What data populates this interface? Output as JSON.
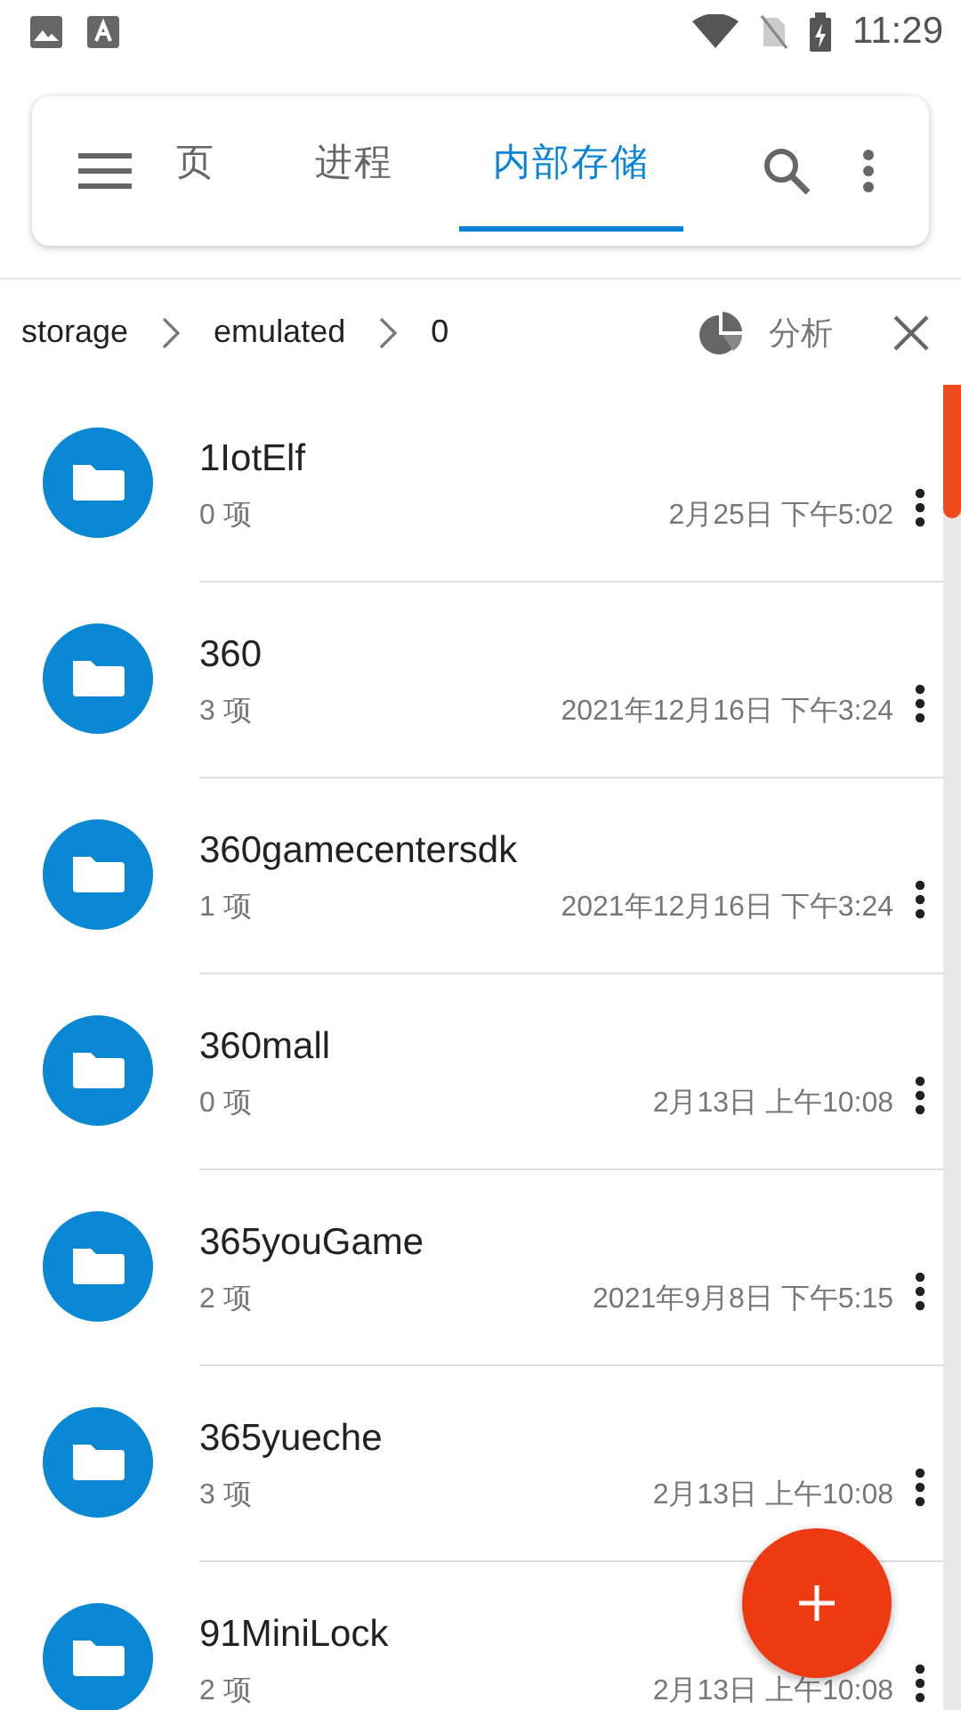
{
  "status_bar": {
    "time": "11:29"
  },
  "toolbar": {
    "tabs": [
      {
        "label": "页",
        "selected": false
      },
      {
        "label": "进程",
        "selected": false
      },
      {
        "label": "内部存储",
        "selected": true
      }
    ]
  },
  "breadcrumb": {
    "parts": [
      "storage",
      "emulated",
      "0"
    ],
    "action": "分析"
  },
  "files": [
    {
      "name": "1IotElf",
      "count": "0 项",
      "modified": "2月25日 下午5:02"
    },
    {
      "name": "360",
      "count": "3 项",
      "modified": "2021年12月16日 下午3:24"
    },
    {
      "name": "360gamecentersdk",
      "count": "1 项",
      "modified": "2021年12月16日 下午3:24"
    },
    {
      "name": "360mall",
      "count": "0 项",
      "modified": "2月13日 上午10:08"
    },
    {
      "name": "365youGame",
      "count": "2 项",
      "modified": "2021年9月8日 下午5:15"
    },
    {
      "name": "365yueche",
      "count": "3 项",
      "modified": "2月13日 上午10:08"
    },
    {
      "name": "91MiniLock",
      "count": "2 项",
      "modified": "2月13日 上午10:08"
    }
  ]
}
